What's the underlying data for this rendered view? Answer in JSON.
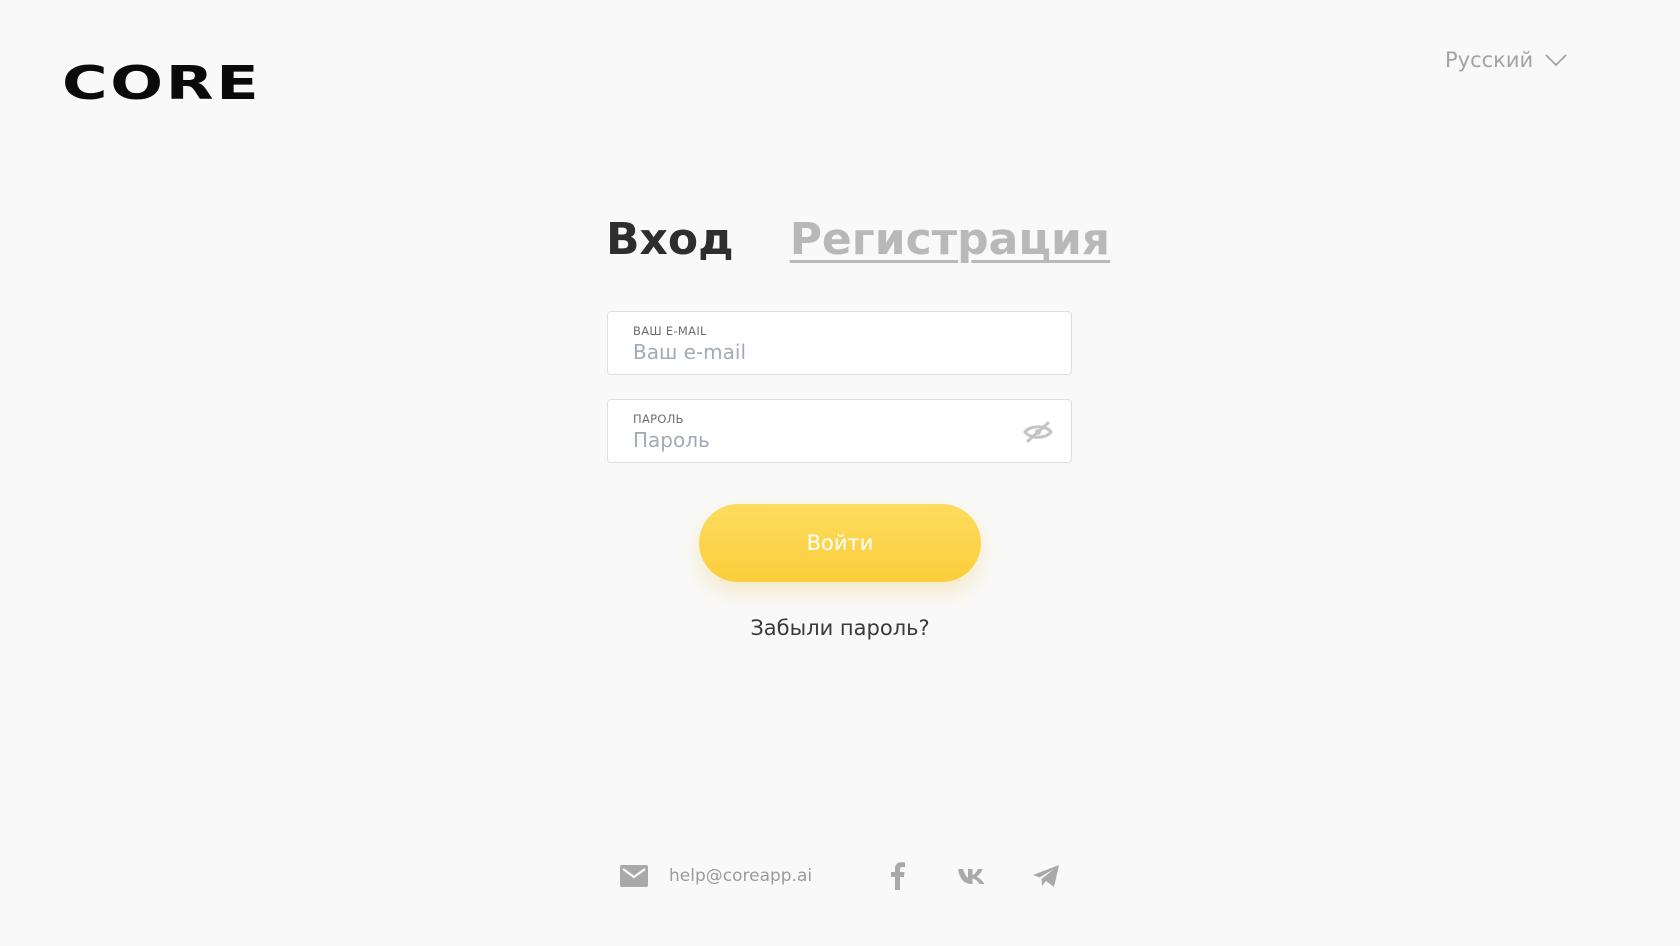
{
  "header": {
    "logo_text": "CORE",
    "language": {
      "selected": "Русский",
      "icon": "chevron-down-icon"
    }
  },
  "auth": {
    "tabs": [
      {
        "label": "Вход",
        "active": true
      },
      {
        "label": "Регистрация",
        "active": false
      }
    ],
    "email_field": {
      "label": "ВАШ E-MAIL",
      "value": "",
      "placeholder": "Ваш e-mail"
    },
    "password_field": {
      "label": "ПАРОЛЬ",
      "value": "",
      "placeholder": "Пароль",
      "toggle_icon": "eye-off-icon"
    },
    "submit_label": "Войти",
    "forgot_label": "Забыли пароль?"
  },
  "footer": {
    "email": "help@coreapp.ai",
    "social_icons": [
      "facebook-icon",
      "vk-icon",
      "telegram-icon"
    ]
  },
  "colors": {
    "background": "#f9f9f9",
    "accent": "#fbcd3a",
    "text_dark": "#2e2e2e",
    "text_muted": "#b8b8b8"
  }
}
